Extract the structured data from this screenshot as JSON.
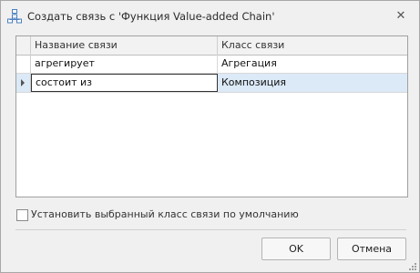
{
  "window": {
    "title": "Создать связь с 'Функция Value-added Chain'",
    "icons": {
      "app": "diagram-link-icon",
      "close": "close-icon"
    },
    "close_glyph": "✕"
  },
  "grid": {
    "columns": [
      "Название связи",
      "Класс связи"
    ],
    "rows": [
      {
        "name": "агрегирует",
        "class": "Агрегация",
        "selected": false
      },
      {
        "name": "состоит из",
        "class": "Композиция",
        "selected": true
      }
    ]
  },
  "options": {
    "default_class_label": "Установить выбранный класс связи по умолчанию",
    "default_class_checked": false
  },
  "buttons": {
    "ok": "OK",
    "cancel": "Отмена"
  },
  "colors": {
    "selection": "#dce9f7",
    "accent_icon": "#4a7fc1"
  }
}
